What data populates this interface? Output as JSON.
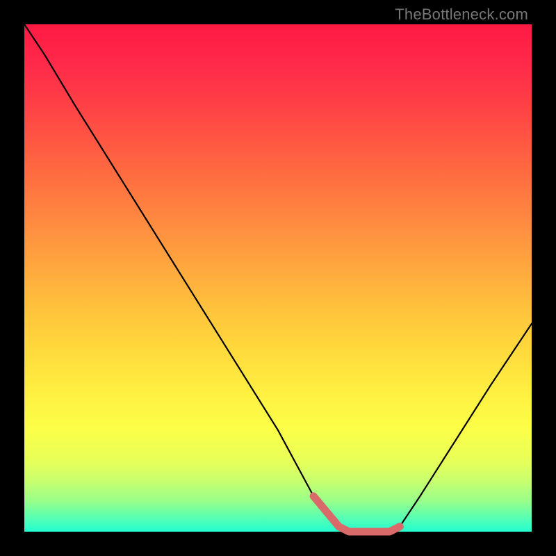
{
  "watermark": "TheBottleneck.com",
  "chart_data": {
    "type": "line",
    "title": "",
    "xlabel": "",
    "ylabel": "",
    "xlim": [
      0,
      100
    ],
    "ylim": [
      0,
      100
    ],
    "background_gradient": {
      "top": "#ff1a44",
      "bottom": "#24ffd0"
    },
    "series": [
      {
        "name": "main-curve",
        "color": "#000000",
        "x": [
          0,
          4,
          10,
          20,
          30,
          40,
          50,
          57,
          62,
          64,
          68,
          72,
          74,
          78,
          85,
          92,
          100
        ],
        "y": [
          100,
          94,
          84,
          68,
          52,
          36,
          20,
          7,
          1,
          0,
          0,
          0,
          1,
          7,
          18,
          29,
          41
        ]
      },
      {
        "name": "highlight-segment",
        "color": "#d96a6a",
        "x": [
          57,
          62,
          64,
          68,
          72,
          74
        ],
        "y": [
          7,
          1,
          0,
          0,
          0,
          1
        ]
      }
    ]
  }
}
